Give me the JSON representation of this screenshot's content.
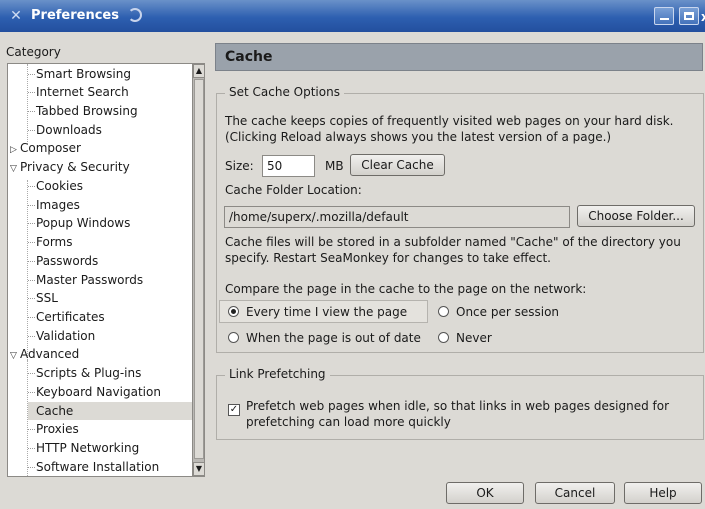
{
  "window": {
    "title": "Preferences"
  },
  "category_label": "Category",
  "tree": {
    "items": [
      {
        "label": "Smart Browsing",
        "level": 1
      },
      {
        "label": "Internet Search",
        "level": 1
      },
      {
        "label": "Tabbed Browsing",
        "level": 1
      },
      {
        "label": "Downloads",
        "level": 1
      },
      {
        "label": "Composer",
        "level": 0,
        "expander": "▷"
      },
      {
        "label": "Privacy & Security",
        "level": 0,
        "expander": "▽"
      },
      {
        "label": "Cookies",
        "level": 1
      },
      {
        "label": "Images",
        "level": 1
      },
      {
        "label": "Popup Windows",
        "level": 1
      },
      {
        "label": "Forms",
        "level": 1
      },
      {
        "label": "Passwords",
        "level": 1
      },
      {
        "label": "Master Passwords",
        "level": 1
      },
      {
        "label": "SSL",
        "level": 1
      },
      {
        "label": "Certificates",
        "level": 1
      },
      {
        "label": "Validation",
        "level": 1
      },
      {
        "label": "Advanced",
        "level": 0,
        "expander": "▽"
      },
      {
        "label": "Scripts & Plug-ins",
        "level": 1
      },
      {
        "label": "Keyboard Navigation",
        "level": 1
      },
      {
        "label": "Cache",
        "level": 1,
        "selected": true
      },
      {
        "label": "Proxies",
        "level": 1
      },
      {
        "label": "HTTP Networking",
        "level": 1
      },
      {
        "label": "Software Installation",
        "level": 1
      }
    ]
  },
  "panel": {
    "title": "Cache",
    "cache_group": {
      "legend": "Set Cache Options",
      "description_line1": "The cache keeps copies of frequently visited web pages on your hard disk.",
      "description_line2": "(Clicking Reload always shows you the latest version of a page.)",
      "size_label": "Size:",
      "size_value": "50",
      "size_unit": "MB",
      "clear_cache_button": "Clear Cache",
      "folder_label": "Cache Folder Location:",
      "folder_path": "/home/superx/.mozilla/default",
      "choose_folder_button": "Choose Folder...",
      "folder_note_line1": "Cache files will be stored in a subfolder named \"Cache\" of the directory you",
      "folder_note_line2": "specify. Restart SeaMonkey for changes to take effect.",
      "compare_label": "Compare the page in the cache to the page on the network:",
      "options": [
        {
          "label": "Every time I view the page",
          "selected": true
        },
        {
          "label": "Once per session",
          "selected": false
        },
        {
          "label": "When the page is out of date",
          "selected": false
        },
        {
          "label": "Never",
          "selected": false
        }
      ]
    },
    "prefetch_group": {
      "legend": "Link Prefetching",
      "checkbox_checked": true,
      "checkbox_line1": "Prefetch web pages when idle, so that links in web pages designed for",
      "checkbox_line2": "prefetching can load more quickly"
    }
  },
  "footer": {
    "ok": "OK",
    "cancel": "Cancel",
    "help": "Help"
  }
}
